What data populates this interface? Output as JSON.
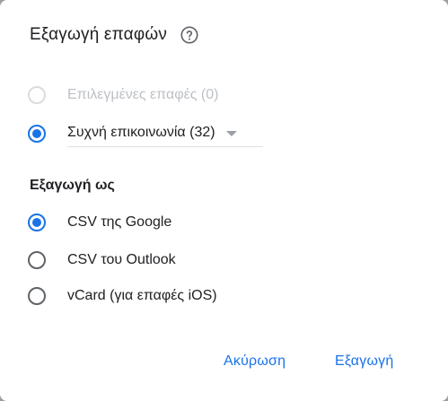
{
  "dialog": {
    "title": "Εξαγωγή επαφών",
    "help_icon": "help-circle-icon"
  },
  "contacts_scope": {
    "options": [
      {
        "label": "Επιλεγμένες επαφές (0)",
        "checked": false,
        "disabled": true
      },
      {
        "label": "Συχνή επικοινωνία (32)",
        "checked": true,
        "disabled": false
      }
    ]
  },
  "export_as": {
    "title": "Εξαγωγή ως",
    "options": [
      {
        "label": "CSV της Google",
        "checked": true
      },
      {
        "label": "CSV του Outlook",
        "checked": false
      },
      {
        "label": "vCard (για επαφές iOS)",
        "checked": false
      }
    ]
  },
  "actions": {
    "cancel_label": "Ακύρωση",
    "export_label": "Εξαγωγή"
  },
  "colors": {
    "accent": "#1a73e8",
    "text": "#202124",
    "disabled_text": "#bdc1c6"
  }
}
